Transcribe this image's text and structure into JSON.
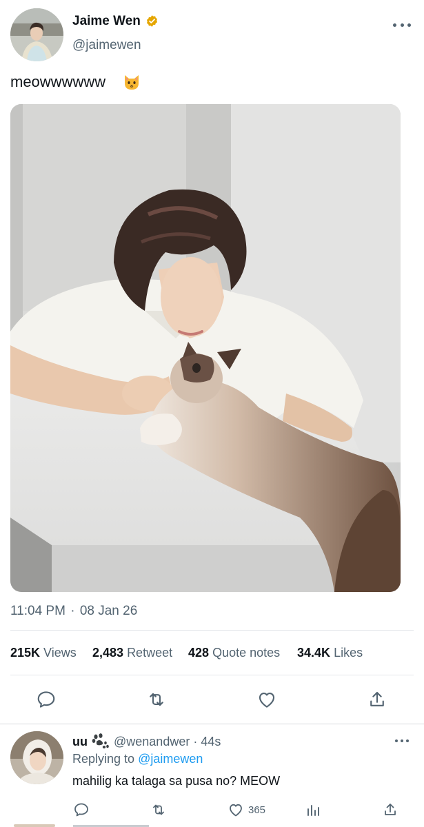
{
  "tweet": {
    "author_name": "Jaime Wen",
    "handle": "@jaimewen",
    "text": "meowwwwww",
    "emoji": "cat-face-icon",
    "time": "11:04 PM",
    "separator": "·",
    "date": "08 Jan 26"
  },
  "stats": {
    "views_count": "215K",
    "views_label": "Views",
    "retweets_count": "2,483",
    "retweets_label": "Retweet",
    "quotes_count": "428",
    "quotes_label": "Quote notes",
    "likes_count": "34.4K",
    "likes_label": "Likes"
  },
  "actions": [
    "reply-icon",
    "retweet-icon",
    "like-icon",
    "share-icon"
  ],
  "reply": {
    "name": "uu",
    "badge": "paw-icon",
    "handle": "@wenandwer",
    "separator": "·",
    "time": "44s",
    "replying_prefix": "Replying to",
    "replying_to": "@jaimewen",
    "text": "mahilig ka talaga sa pusa no? MEOW",
    "like_count": "365"
  },
  "colors": {
    "primary_text": "#0f1419",
    "secondary_text": "#536471",
    "link": "#1d9bf0",
    "verified_badge": "#e5a600",
    "divider": "#e3e7ea"
  }
}
